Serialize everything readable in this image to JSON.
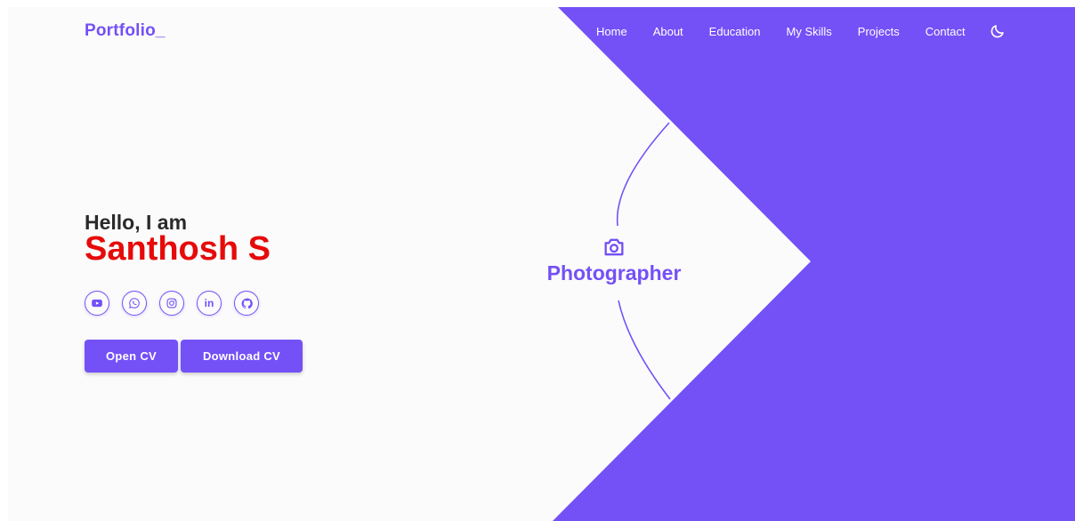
{
  "brand": {
    "logo_text": "Portfolio_"
  },
  "nav": {
    "items": [
      {
        "label": "Home"
      },
      {
        "label": "About"
      },
      {
        "label": "Education"
      },
      {
        "label": "My Skills"
      },
      {
        "label": "Projects"
      },
      {
        "label": "Contact"
      }
    ],
    "theme_toggle_icon": "moon-icon"
  },
  "hero": {
    "greeting": "Hello, I am",
    "name": "Santhosh S",
    "socials": [
      {
        "icon": "youtube-icon"
      },
      {
        "icon": "whatsapp-icon"
      },
      {
        "icon": "instagram-icon"
      },
      {
        "icon": "linkedin-icon",
        "glyph": "in"
      },
      {
        "icon": "github-icon"
      }
    ],
    "buttons": {
      "open_cv": "Open CV",
      "download_cv": "Download CV"
    }
  },
  "role": {
    "icon": "camera-icon",
    "title": "Photographer"
  },
  "colors": {
    "accent": "#7450f7",
    "name": "#e60a0a",
    "background": "#fbfbfb",
    "text_dark": "#2a2a2a"
  }
}
